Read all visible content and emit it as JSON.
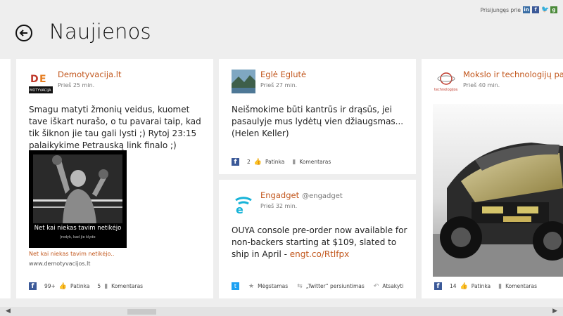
{
  "header": {
    "title": "Naujienos",
    "login_label": "Prisijungęs prie"
  },
  "cards": [
    {
      "source": "Demotyvacija.lt",
      "time": "Prieš 25 min.",
      "text": "Smagu matyti žmonių veidus, kuomet tave iškart nurašo, o tu pavarai taip, kad tik šiknon jie tau gali lysti ;) Rytoj 23:15 palaikykime Petrauską link finalo ;)",
      "image_caption": "Net kai niekas tavim netikėjo",
      "image_subcaption": "Įrodyk, kad jie klydo",
      "avatar_text": "DE\nMOTYVACIJA",
      "link_title": "Net kai niekas tavim netikėjo..",
      "link_url": "www.demotyvacijos.lt",
      "likes": "99+",
      "like_label": "Patinka",
      "comments": "5",
      "comment_label": "Komentaras"
    },
    {
      "source": "Eglė Eglutė",
      "time": "Prieš 27 min.",
      "text": "Neišmokime būti kantrūs ir drąsūs, jei pasaulyje mus lydėtų vien džiaugsmas... (Helen Keller)",
      "likes": "2",
      "like_label": "Patinka",
      "comment_label": "Komentaras"
    },
    {
      "source": "Engadget",
      "handle": "@engadget",
      "time": "Prieš 32 min.",
      "text": "OUYA console pre-order now available for non-backers starting at $109, slated to ship in April - ",
      "link": "engt.co/Rtlfpx",
      "favorite_label": "Mėgstamas",
      "retweet_label": "„Twitter“ persiuntimas",
      "reply_label": "Atsakyti"
    },
    {
      "source": "Mokslo ir technologijų pasaulis",
      "avatar_text": "technologijos.lt",
      "time": "Prieš 40 min.",
      "likes": "14",
      "like_label": "Patinka",
      "comment_label": "Komentaras"
    }
  ]
}
